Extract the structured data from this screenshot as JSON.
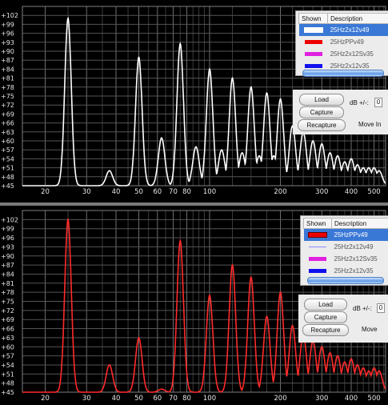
{
  "chart_data": [
    {
      "type": "line",
      "xscale": "log",
      "xlim": [
        16,
        560
      ],
      "ylim": [
        45,
        105
      ],
      "grid": true,
      "xticks": [
        20,
        30,
        40,
        50,
        60,
        70,
        80,
        100,
        200,
        300,
        400,
        500
      ],
      "yticks": [
        45,
        48,
        51,
        54,
        57,
        60,
        63,
        66,
        69,
        72,
        75,
        78,
        81,
        84,
        87,
        90,
        93,
        96,
        99,
        102
      ],
      "ytick_labels": [
        "+45",
        "+48",
        "+51",
        "+54",
        "+57",
        "+60",
        "+63",
        "+66",
        "+69",
        "+72",
        "+75",
        "+78",
        "+81",
        "+84",
        "+87",
        "+90",
        "+93",
        "+96",
        "+99",
        "+102"
      ],
      "series": [
        {
          "name": "25Hz2x12v49",
          "color": "#ffffff",
          "peaks": [
            [
              25,
              101
            ],
            [
              37.5,
              50
            ],
            [
              50,
              88
            ],
            [
              62.5,
              61
            ],
            [
              75,
              92.5
            ],
            [
              87.5,
              58
            ],
            [
              100,
              84
            ],
            [
              112.5,
              57
            ],
            [
              125,
              81
            ],
            [
              137.5,
              56
            ],
            [
              150,
              78
            ],
            [
              162.5,
              55
            ],
            [
              175,
              76
            ],
            [
              187.5,
              55
            ],
            [
              200,
              74
            ],
            [
              225,
              65
            ],
            [
              250,
              63
            ],
            [
              275,
              60
            ],
            [
              300,
              59
            ],
            [
              325,
              56
            ],
            [
              350,
              55
            ],
            [
              375,
              53
            ],
            [
              400,
              54
            ],
            [
              425,
              52
            ],
            [
              450,
              51
            ],
            [
              475,
              51
            ],
            [
              500,
              51
            ],
            [
              525,
              50
            ]
          ],
          "baseline": 45
        }
      ]
    },
    {
      "type": "line",
      "xscale": "log",
      "xlim": [
        16,
        560
      ],
      "ylim": [
        45,
        105
      ],
      "grid": true,
      "xticks": [
        20,
        30,
        40,
        50,
        60,
        70,
        80,
        100,
        200,
        300,
        400,
        500
      ],
      "yticks": [
        45,
        48,
        51,
        54,
        57,
        60,
        63,
        66,
        69,
        72,
        75,
        78,
        81,
        84,
        87,
        90,
        93,
        96,
        99,
        102
      ],
      "ytick_labels": [
        "+45",
        "+48",
        "+51",
        "+54",
        "+57",
        "+60",
        "+63",
        "+66",
        "+69",
        "+72",
        "+75",
        "+78",
        "+81",
        "+84",
        "+87",
        "+90",
        "+93",
        "+96",
        "+99",
        "+102"
      ],
      "series": [
        {
          "name": "25HzPPv49",
          "color": "#ff2a2a",
          "peaks": [
            [
              25,
              102
            ],
            [
              37.5,
              54
            ],
            [
              50,
              63
            ],
            [
              62.5,
              46
            ],
            [
              75,
              95
            ],
            [
              100,
              77
            ],
            [
              125,
              87
            ],
            [
              150,
              83
            ],
            [
              175,
              70
            ],
            [
              200,
              78
            ],
            [
              225,
              67
            ],
            [
              250,
              64
            ],
            [
              275,
              62
            ],
            [
              300,
              60
            ],
            [
              325,
              58
            ],
            [
              350,
              57
            ],
            [
              375,
              55
            ],
            [
              400,
              56
            ],
            [
              425,
              54
            ],
            [
              450,
              53
            ],
            [
              475,
              52
            ],
            [
              500,
              53
            ],
            [
              525,
              52
            ]
          ],
          "baseline": 45
        }
      ]
    }
  ],
  "top_panel": {
    "legend": {
      "col_shown": "Shown",
      "col_description": "Description",
      "rows": [
        {
          "description": "25Hz2x12v49",
          "color": "#ffffff",
          "selected": true
        },
        {
          "description": "25HzPPv49",
          "color": "#ff0000",
          "selected": false
        },
        {
          "description": "25Hz2x12Sv35",
          "color": "#ff00ff",
          "selected": false
        },
        {
          "description": "25Hz2x12v35",
          "color": "#0000ff",
          "selected": false
        }
      ]
    },
    "buttons": {
      "load": "Load",
      "capture": "Capture",
      "recapture": "Recapture"
    },
    "db_label": "dB +/-:",
    "db_value": "0",
    "move_label": "Move In"
  },
  "bottom_panel": {
    "legend": {
      "col_shown": "Shown",
      "col_description": "Description",
      "rows": [
        {
          "description": "25HzPPv49",
          "color": "#ff0000",
          "selected": true
        },
        {
          "description": "25Hz2x12v49",
          "color": "#ffffff",
          "selected": false
        },
        {
          "description": "25Hz2x12Sv35",
          "color": "#ff00ff",
          "selected": false
        },
        {
          "description": "25Hz2x12v35",
          "color": "#0000ff",
          "selected": false
        }
      ]
    },
    "buttons": {
      "load": "Load",
      "capture": "Capture",
      "recapture": "Recapture"
    },
    "db_label": "dB +/-:",
    "db_value": "0",
    "move_label": "Move"
  }
}
